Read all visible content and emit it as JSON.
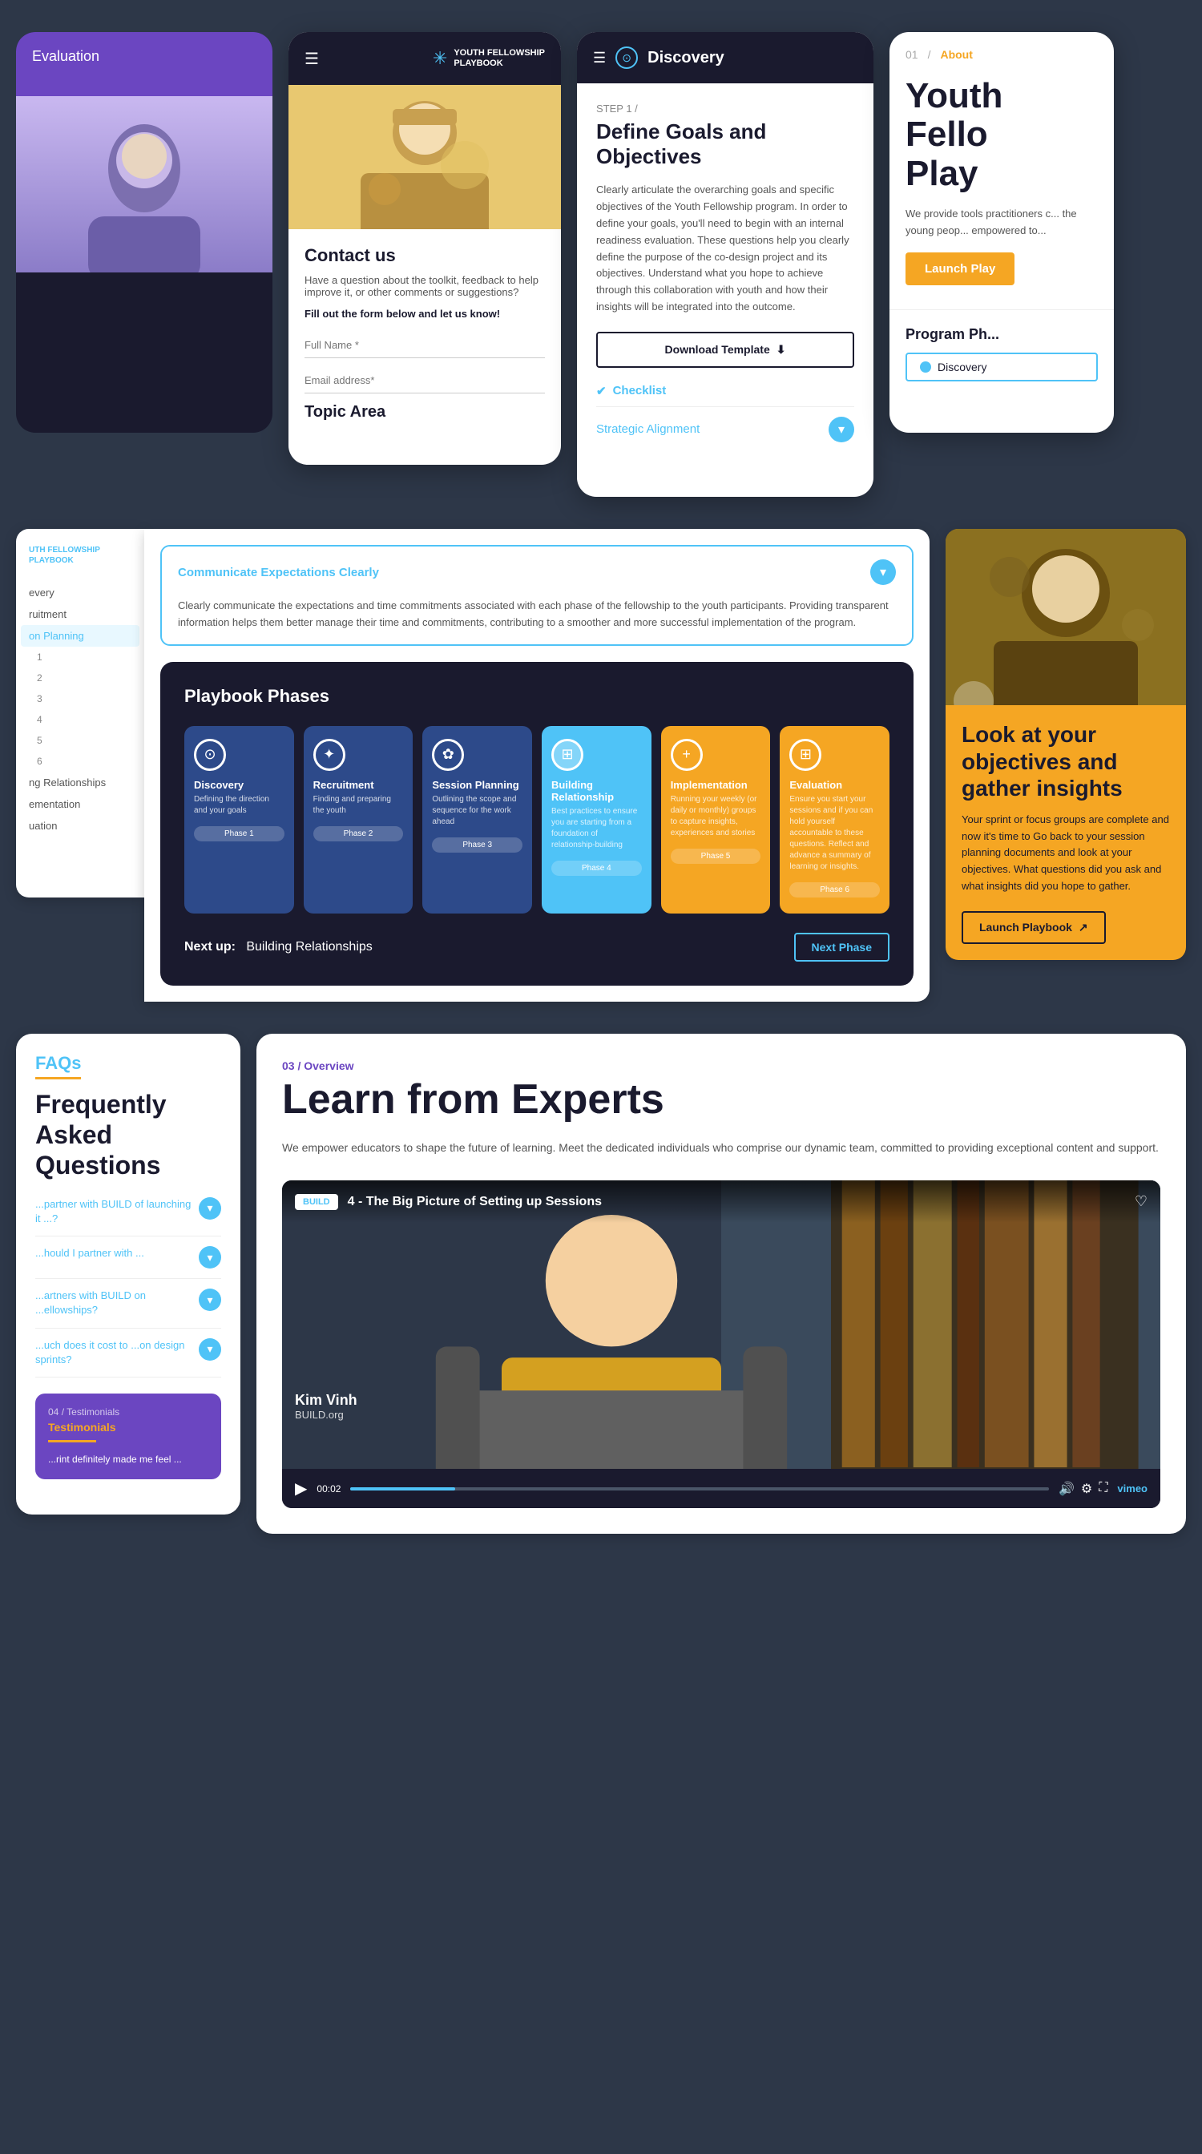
{
  "app": {
    "title": "Youth Fellowship Playbook"
  },
  "row1": {
    "card_purple": {
      "nav_item1": "Evaluation",
      "color": "#6b46c1"
    },
    "card_contact": {
      "logo_line1": "YOUTH FELLOWSHIP",
      "logo_line2": "PLAYBOOK",
      "title": "Contact us",
      "description": "Have a question about the toolkit, feedback to help improve it, or other comments or suggestions?",
      "cta": "Fill out the form below and let us know!",
      "input1_placeholder": "Full Name *",
      "input2_placeholder": "Email address*",
      "section_title": "Topic Area"
    },
    "card_discovery": {
      "header_title": "Discovery",
      "step_label": "STEP 1 /",
      "main_title": "Define Goals and Objectives",
      "description": "Clearly articulate the overarching goals and specific objectives of the Youth Fellowship program. In order to define your goals, you'll need to begin with an internal readiness evaluation. These questions help you clearly define the purpose of the co-design project and its objectives. Understand what you hope to achieve through this collaboration with youth and how their insights will be integrated into the outcome.",
      "download_btn": "Download Template",
      "checklist_label": "Checklist",
      "strategic_label": "Strategic Alignment"
    },
    "card_about": {
      "num": "01",
      "label": "About",
      "title_line1": "Yout",
      "title_line2": "Fello",
      "title_line3": "Play",
      "description": "We provide tools practitioners c... the young peop... empowered to...",
      "launch_btn": "Launch Play",
      "program_phase_title": "Program Ph...",
      "phase_name": "Discovery"
    }
  },
  "row2": {
    "sidebar": {
      "logo_line1": "UTH FELLOWSHIP",
      "logo_line2": "PLAYBOOK",
      "items": [
        {
          "label": "every",
          "active": false
        },
        {
          "label": "ruitment",
          "active": false
        },
        {
          "label": "on Planning",
          "active": true
        },
        {
          "label": "1",
          "active": false,
          "sub": true
        },
        {
          "label": "2",
          "active": false,
          "sub": true
        },
        {
          "label": "3",
          "active": false,
          "sub": true
        },
        {
          "label": "4",
          "active": false,
          "sub": true
        },
        {
          "label": "5",
          "active": false,
          "sub": true
        },
        {
          "label": "6",
          "active": false,
          "sub": true
        },
        {
          "label": "ng Relationships",
          "active": false
        },
        {
          "label": "ementation",
          "active": false
        },
        {
          "label": "uation",
          "active": false
        }
      ]
    },
    "accordion": {
      "title": "Communicate Expectations Clearly",
      "body": "Clearly communicate the expectations and time commitments associated with each phase of the fellowship to the youth participants. Providing transparent information helps them better manage their time and commitments, contributing to a smoother and more successful implementation of the program."
    },
    "phases": {
      "section_title": "Playbook Phases",
      "cards": [
        {
          "icon": "⊙",
          "name": "Discovery",
          "sub": "Defining the direction and your goals",
          "label": "Phase 1",
          "color_class": "p1"
        },
        {
          "icon": "✦",
          "name": "Recruitment",
          "sub": "Finding and preparing the youth",
          "label": "Phase 2",
          "color_class": "p2"
        },
        {
          "icon": "✿",
          "name": "Session Planning",
          "sub": "Outlining the scope and sequence for the work ahead",
          "label": "Phase 3",
          "color_class": "p3"
        },
        {
          "icon": "⊞",
          "name": "Building Relationship",
          "sub": "Best practices to ensure you are starting from a foundation of relationship-building",
          "label": "Phase 4",
          "color_class": "p4"
        },
        {
          "icon": "+",
          "name": "Implementation",
          "sub": "Running your weekly (or daily or monthly) groups to capture insights, experiences and stories",
          "label": "Phase 5",
          "color_class": "p5"
        },
        {
          "icon": "⊞",
          "name": "Evaluation",
          "sub": "Ensure you start your sessions and if you can hold yourself accountable to these questions. Reflect and advance a summary of learning or insights.",
          "label": "Phase 6",
          "color_class": "p6"
        }
      ],
      "next_up_label": "Next up:",
      "next_up_value": "Building Relationships",
      "next_phase_btn": "Next Phase"
    },
    "card_yellow": {
      "title": "Look at your objectives and gather insights",
      "description": "Your sprint or focus groups are complete and now it's time to Go back to your session planning documents and look at your objectives. What questions did you ask and what insights did you hope to gather.",
      "btn_label": "Launch Playbook",
      "btn_arrow": "↗"
    }
  },
  "row3": {
    "card_faq": {
      "tag": "FAQs",
      "title": "Frequently Asked Questions",
      "items": [
        {
          "question": "...partner with BUILD of launching it ...?"
        },
        {
          "question": "...hould I partner with ..."
        },
        {
          "question": "...artners with BUILD on ...ellowships?"
        },
        {
          "question": "...uch does it cost to ...on design sprints?"
        }
      ],
      "testimonial": {
        "num": "04",
        "label": "Testimonials",
        "quote": "...rint definitely made me feel ..."
      }
    },
    "card_learn": {
      "step_num": "03",
      "step_label": "Overview",
      "title": "Learn from Experts",
      "description": "We empower educators to shape the future of learning. Meet the dedicated individuals who comprise our dynamic team, committed to providing exceptional content and support.",
      "video": {
        "title": "4 - The Big Picture of Setting up Sessions",
        "channel": "BUILD",
        "time": "00:02",
        "person_name": "Kim Vinh",
        "person_org": "BUILD.org",
        "platform": "vimeo"
      }
    }
  }
}
